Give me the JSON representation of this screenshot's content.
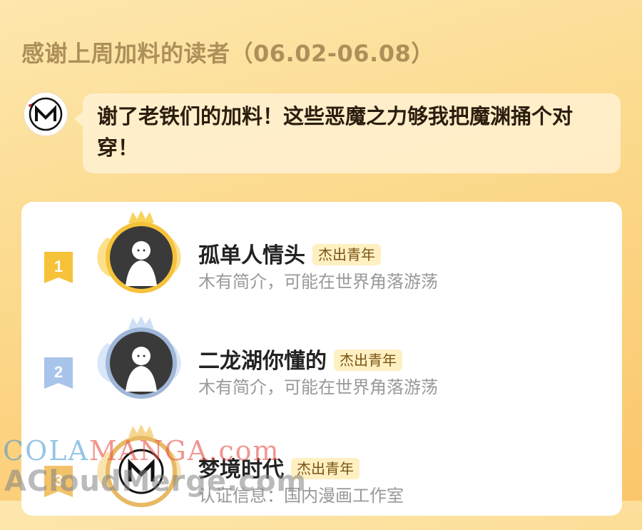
{
  "header": {
    "title": "感谢上周加料的读者（06.02-06.08）"
  },
  "author": {
    "avatar_icon": "m-logo-icon",
    "message": "谢了老铁们的加料！这些恶魔之力够我把魔渊捅个对穿！"
  },
  "ranking": [
    {
      "rank": "1",
      "name": "孤单人情头",
      "badge": "杰出青年",
      "desc": "木有简介，可能在世界角落游荡",
      "frame": "gold"
    },
    {
      "rank": "2",
      "name": "二龙湖你懂的",
      "badge": "杰出青年",
      "desc": "木有简介，可能在世界角落游荡",
      "frame": "silver"
    },
    {
      "rank": "3",
      "name": "梦境时代",
      "badge": "杰出青年",
      "desc": "认证信息：国内漫画工作室",
      "frame": "bronze"
    }
  ],
  "watermark": {
    "line1_a": "COLA",
    "line1_b": "MANGA",
    "line1_c": ".com",
    "line2": "ACloudMerge.com"
  },
  "colors": {
    "gold": "#f5c23a",
    "silver": "#a9c4ea",
    "title": "#ad8f5a"
  }
}
